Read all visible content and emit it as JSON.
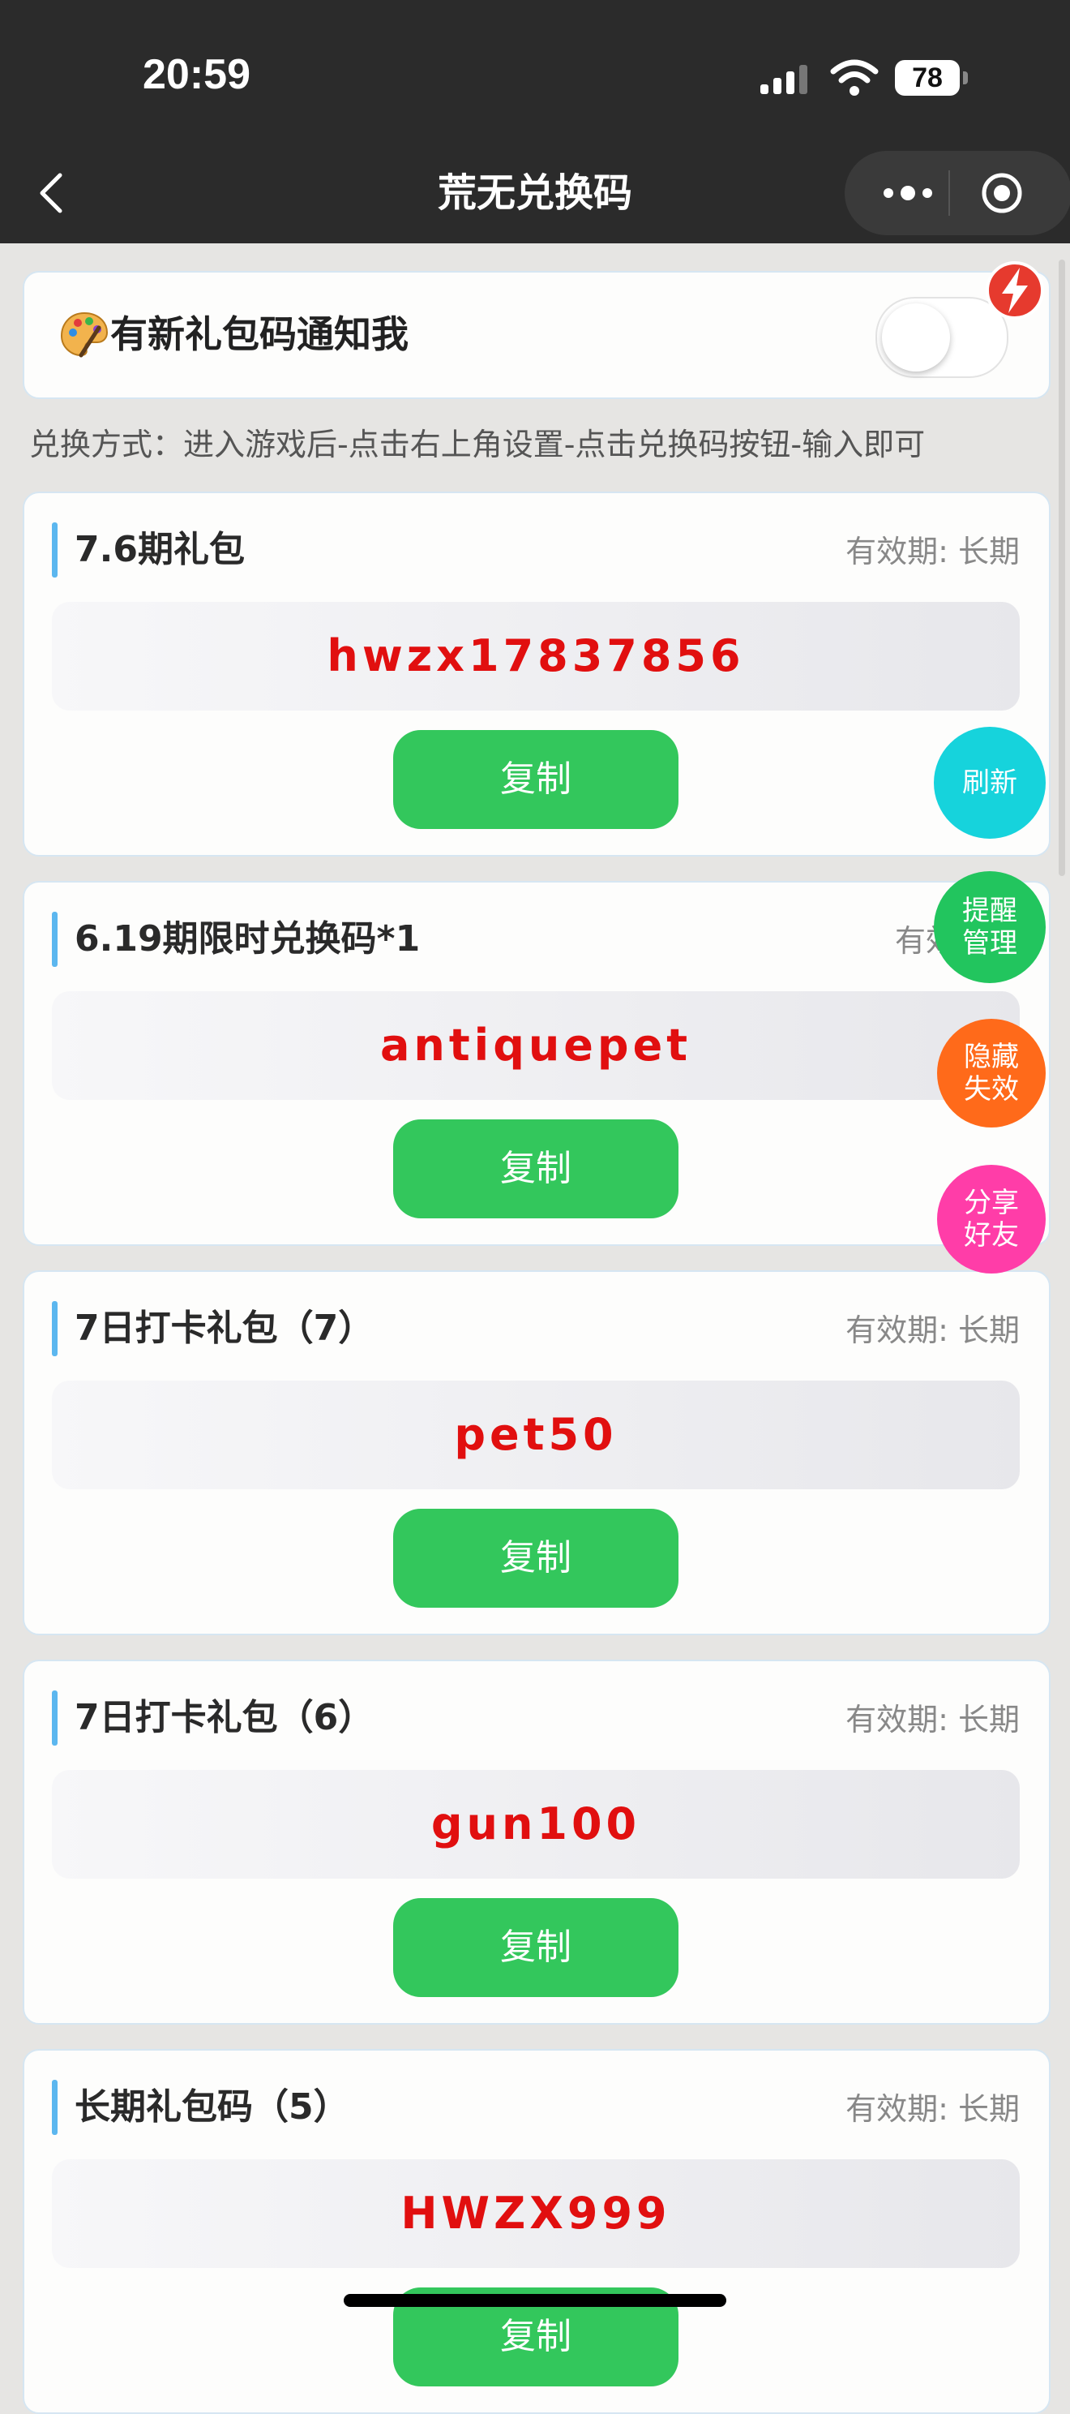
{
  "status_bar": {
    "time": "20:59",
    "battery": "78"
  },
  "nav": {
    "title": "荒无兑换码"
  },
  "notify": {
    "label": "有新礼包码通知我",
    "enabled": false
  },
  "instructions": "兑换方式：进入游戏后-点击右上角设置-点击兑换码按钮-输入即可",
  "cards": [
    {
      "title": "7.6期礼包",
      "validity": "有效期: 长期",
      "code": "hwzx17837856",
      "copy_label": "复制"
    },
    {
      "title": "6.19期限时兑换码*1",
      "validity": "有效期",
      "code": "antiquepet",
      "copy_label": "复制"
    },
    {
      "title": "7日打卡礼包（7）",
      "validity": "有效期: 长期",
      "code": "pet50",
      "copy_label": "复制"
    },
    {
      "title": "7日打卡礼包（6）",
      "validity": "有效期: 长期",
      "code": "gun100",
      "copy_label": "复制"
    },
    {
      "title": "长期礼包码（5）",
      "validity": "有效期: 长期",
      "code": "HWZX999",
      "copy_label": "复制"
    }
  ],
  "floating": {
    "refresh": "刷新",
    "reminder": "提醒管理",
    "hide_expired": "隐藏失效",
    "share": "分享好友"
  },
  "colors": {
    "accent_green": "#33c75c",
    "code_red": "#e10f0f",
    "refresh_cyan": "#16d3dc",
    "reminder_green": "#22c55e",
    "hide_orange": "#ff6a1a",
    "share_pink": "#ff3da8"
  }
}
